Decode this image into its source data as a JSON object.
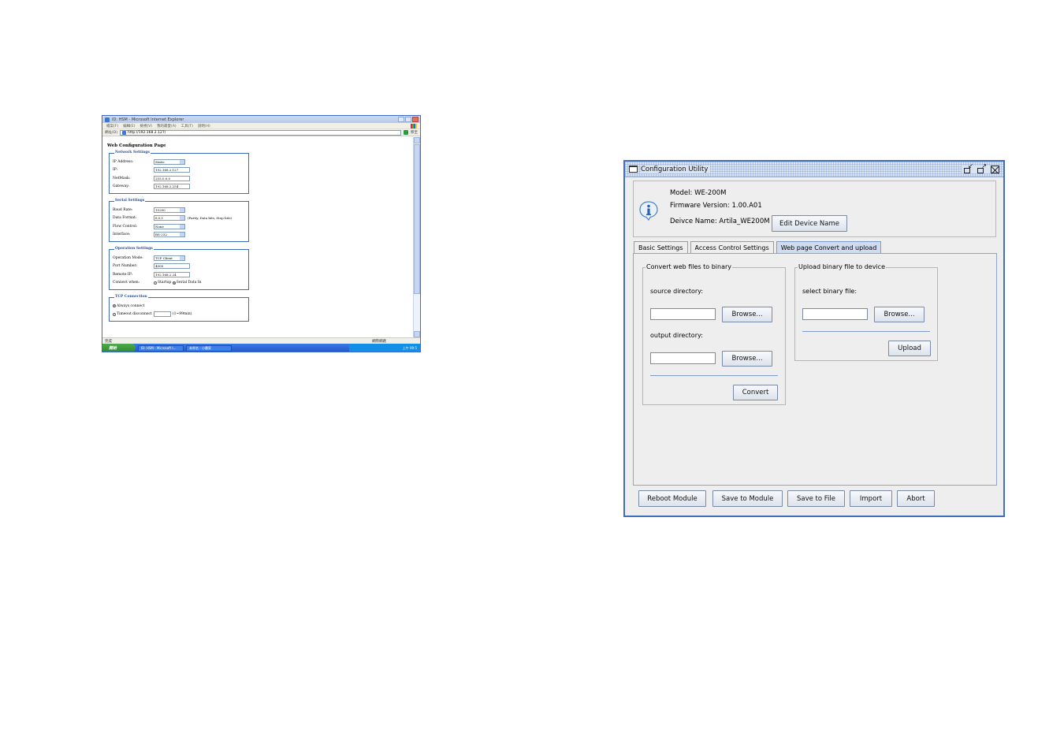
{
  "browser": {
    "title": "ID: HSM - Microsoft Internet Explorer",
    "menu": [
      "檔案(F)",
      "編輯(E)",
      "檢視(V)",
      "我的最愛(A)",
      "工具(T)",
      "說明(H)"
    ],
    "address_label": "網址(D)",
    "address": "http://192.168.2.127/",
    "go_label": "移至",
    "page": {
      "title": "Web Configuration Page",
      "network": {
        "legend": "Network Settings",
        "ip_address_label": "IP Address:",
        "ip_address_value": "Static",
        "ip_label": "IP:",
        "ip_value": "192.168.2.127",
        "netmask_label": "NetMask:",
        "netmask_value": "255.0.0.0",
        "gateway_label": "Gateway:",
        "gateway_value": "192.168.2.254"
      },
      "serial": {
        "legend": "Serial Settings",
        "baud_label": "Baud Rate:",
        "baud_value": "15200",
        "format_label": "Data Format:",
        "format_value": "8,0,1",
        "format_note": "(Parity, Data bits, Stop bits)",
        "flow_label": "Flow Control:",
        "flow_value": "None",
        "iface_label": "Interface:",
        "iface_value": "RS-232"
      },
      "operation": {
        "legend": "Operation Settings",
        "mode_label": "Operation Mode:",
        "mode_value": "TCP Client",
        "port_label": "Port Number:",
        "port_value": "4000",
        "remote_label": "Remote IP:",
        "remote_value": "192.168.2.24",
        "connect_label": "Connect when:",
        "opt_startup": "Startup",
        "opt_serial": "Serial Data In"
      },
      "tcp": {
        "legend": "TCP Connection",
        "always": "Always connect",
        "timeout": "Timeout disconnect",
        "timeout_unit": "(1~99min)"
      }
    },
    "status_left": "完成",
    "status_right": "網際網路",
    "start_label": "開始",
    "task1": "ID: HSM - Microsoft I...",
    "task2": "未命名 - 小畫家",
    "clock": "上午 09:5"
  },
  "config_utility": {
    "title": "Configuration Utility",
    "model": "Model: WE-200M",
    "firmware": "Firmware Version: 1.00.A01",
    "device_name": "Deivce Name: Artila_WE200M",
    "edit_device_name": "Edit Device Name",
    "tabs": [
      "Basic Settings",
      "Access Control Settings",
      "Web page Convert and upload"
    ],
    "active_tab": 2,
    "convert": {
      "legend": "Convert web files to binary",
      "source_label": "source directory:",
      "source_value": "",
      "browse1": "Browse...",
      "output_label": "output directory:",
      "output_value": "",
      "browse2": "Browse...",
      "convert_button": "Convert"
    },
    "upload": {
      "legend": "Upload binary file to device",
      "select_label": "select binary file:",
      "select_value": "",
      "browse": "Browse...",
      "upload_button": "Upload"
    },
    "bottom_buttons": {
      "reboot": "Reboot Module",
      "save_module": "Save to Module",
      "save_file": "Save to File",
      "import": "Import",
      "abort": "Abort"
    }
  }
}
